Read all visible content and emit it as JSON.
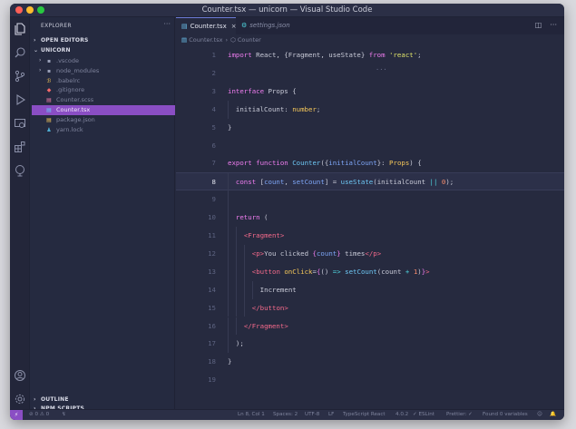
{
  "window": {
    "title": "Counter.tsx — unicorn — Visual Studio Code"
  },
  "activity_icons": [
    "explorer-icon",
    "search-icon",
    "source-control-icon",
    "run-debug-icon",
    "remote-explorer-icon",
    "extensions-icon",
    "live-share-icon",
    "account-icon",
    "settings-gear-icon"
  ],
  "sidebar": {
    "header": "EXPLORER",
    "more": "···",
    "open_editors": "OPEN EDITORS",
    "project": "UNICORN",
    "items": [
      {
        "label": ".vscode",
        "icon": "folder-icon",
        "icon_char": "▪",
        "chev": "›"
      },
      {
        "label": "node_modules",
        "icon": "folder-icon",
        "icon_char": "▪",
        "chev": "›"
      },
      {
        "label": ".babelrc",
        "icon": "babel-file-icon",
        "icon_char": "ℬ",
        "chev": ""
      },
      {
        "label": ".gitignore",
        "icon": "git-file-icon",
        "icon_char": "◆",
        "chev": ""
      },
      {
        "label": "Counter.scss",
        "icon": "scss-file-icon",
        "icon_char": "▤",
        "chev": ""
      },
      {
        "label": "Counter.tsx",
        "icon": "tsx-file-icon",
        "icon_char": "▤",
        "chev": "",
        "selected": true
      },
      {
        "label": "package.json",
        "icon": "json-file-icon",
        "icon_char": "▤",
        "chev": ""
      },
      {
        "label": "yarn.lock",
        "icon": "yarn-file-icon",
        "icon_char": "♟",
        "chev": ""
      }
    ],
    "outline": "OUTLINE",
    "npm_scripts": "NPM SCRIPTS"
  },
  "tabs": [
    {
      "label": "Counter.tsx",
      "close": "×",
      "active": true
    },
    {
      "label": "settings.json",
      "active": false
    }
  ],
  "breadcrumb": {
    "file": "Counter.tsx",
    "sep": "›",
    "symbol": "Counter"
  },
  "editor": {
    "current_line": 8,
    "hint": "···",
    "lines": [
      {
        "n": "1",
        "indent": 0,
        "tokens": [
          [
            "kw",
            "import"
          ],
          [
            "punc",
            " React, {Fragment, useState} "
          ],
          [
            "kw",
            "from"
          ],
          [
            "punc",
            " "
          ],
          [
            "str",
            "'react'"
          ],
          [
            "punc",
            ";"
          ]
        ]
      },
      {
        "n": "2",
        "indent": 0,
        "tokens": []
      },
      {
        "n": "3",
        "indent": 0,
        "tokens": [
          [
            "kw",
            "interface"
          ],
          [
            "punc",
            " Props {"
          ]
        ]
      },
      {
        "n": "4",
        "indent": 1,
        "tokens": [
          [
            "punc",
            "initialCount: "
          ],
          [
            "ty",
            "number"
          ],
          [
            "punc",
            ";"
          ]
        ]
      },
      {
        "n": "5",
        "indent": 0,
        "tokens": [
          [
            "punc",
            "}"
          ]
        ]
      },
      {
        "n": "6",
        "indent": 0,
        "tokens": []
      },
      {
        "n": "7",
        "indent": 0,
        "tokens": [
          [
            "kw",
            "export"
          ],
          [
            "punc",
            " "
          ],
          [
            "kw",
            "function"
          ],
          [
            "punc",
            " "
          ],
          [
            "fn",
            "Counter"
          ],
          [
            "punc",
            "({"
          ],
          [
            "kw2",
            "initialCount"
          ],
          [
            "punc",
            "}: "
          ],
          [
            "ty",
            "Props"
          ],
          [
            "punc",
            ") {"
          ]
        ]
      },
      {
        "n": "8",
        "indent": 1,
        "tokens": [
          [
            "kw",
            "const"
          ],
          [
            "punc",
            " ["
          ],
          [
            "kw2",
            "count"
          ],
          [
            "punc",
            ", "
          ],
          [
            "kw2",
            "setCount"
          ],
          [
            "punc",
            "] = "
          ],
          [
            "fn",
            "useState"
          ],
          [
            "punc",
            "(initialCount "
          ],
          [
            "op",
            "||"
          ],
          [
            "punc",
            " "
          ],
          [
            "num",
            "0"
          ],
          [
            "punc",
            ");"
          ]
        ]
      },
      {
        "n": "9",
        "indent": 1,
        "tokens": []
      },
      {
        "n": "10",
        "indent": 1,
        "tokens": [
          [
            "kw",
            "return"
          ],
          [
            "punc",
            " ("
          ]
        ]
      },
      {
        "n": "11",
        "indent": 2,
        "tokens": [
          [
            "tag",
            "<Fragment>"
          ]
        ]
      },
      {
        "n": "12",
        "indent": 3,
        "tokens": [
          [
            "tag",
            "<p>"
          ],
          [
            "punc",
            "You clicked "
          ],
          [
            "br1",
            "{"
          ],
          [
            "kw2",
            "count"
          ],
          [
            "br1",
            "}"
          ],
          [
            "punc",
            " times"
          ],
          [
            "tag",
            "</p>"
          ]
        ]
      },
      {
        "n": "13",
        "indent": 3,
        "tokens": [
          [
            "tag",
            "<button"
          ],
          [
            "punc",
            " "
          ],
          [
            "attr",
            "onClick"
          ],
          [
            "punc",
            "="
          ],
          [
            "br1",
            "{"
          ],
          [
            "punc",
            "() "
          ],
          [
            "op",
            "=>"
          ],
          [
            "punc",
            " "
          ],
          [
            "fn",
            "setCount"
          ],
          [
            "punc",
            "(count "
          ],
          [
            "op",
            "+"
          ],
          [
            "punc",
            " "
          ],
          [
            "num",
            "1"
          ],
          [
            "punc",
            ")"
          ],
          [
            "br1",
            "}"
          ],
          [
            "tag",
            ">"
          ]
        ]
      },
      {
        "n": "14",
        "indent": 4,
        "tokens": [
          [
            "punc",
            "Increment"
          ]
        ]
      },
      {
        "n": "15",
        "indent": 3,
        "tokens": [
          [
            "tag",
            "</button>"
          ]
        ]
      },
      {
        "n": "16",
        "indent": 2,
        "tokens": [
          [
            "tag",
            "</Fragment>"
          ]
        ]
      },
      {
        "n": "17",
        "indent": 1,
        "tokens": [
          [
            "punc",
            ");"
          ]
        ]
      },
      {
        "n": "18",
        "indent": 0,
        "tokens": [
          [
            "punc",
            "}"
          ]
        ]
      },
      {
        "n": "19",
        "indent": 0,
        "tokens": []
      }
    ]
  },
  "statusbar": {
    "remote": "⚡",
    "problems": "⊘ 0 ⚠ 0",
    "sync": "↯",
    "position": "Ln 8, Col 1",
    "spaces": "Spaces: 2",
    "encoding": "UTF-8",
    "eol": "LF",
    "language": "TypeScript React",
    "version": "4.0.2",
    "eslint": "✓ ESLint",
    "prettier": "Prettier: ✓",
    "variables": "Found 0 variables",
    "feedback": "☺",
    "bell": "🔔"
  }
}
